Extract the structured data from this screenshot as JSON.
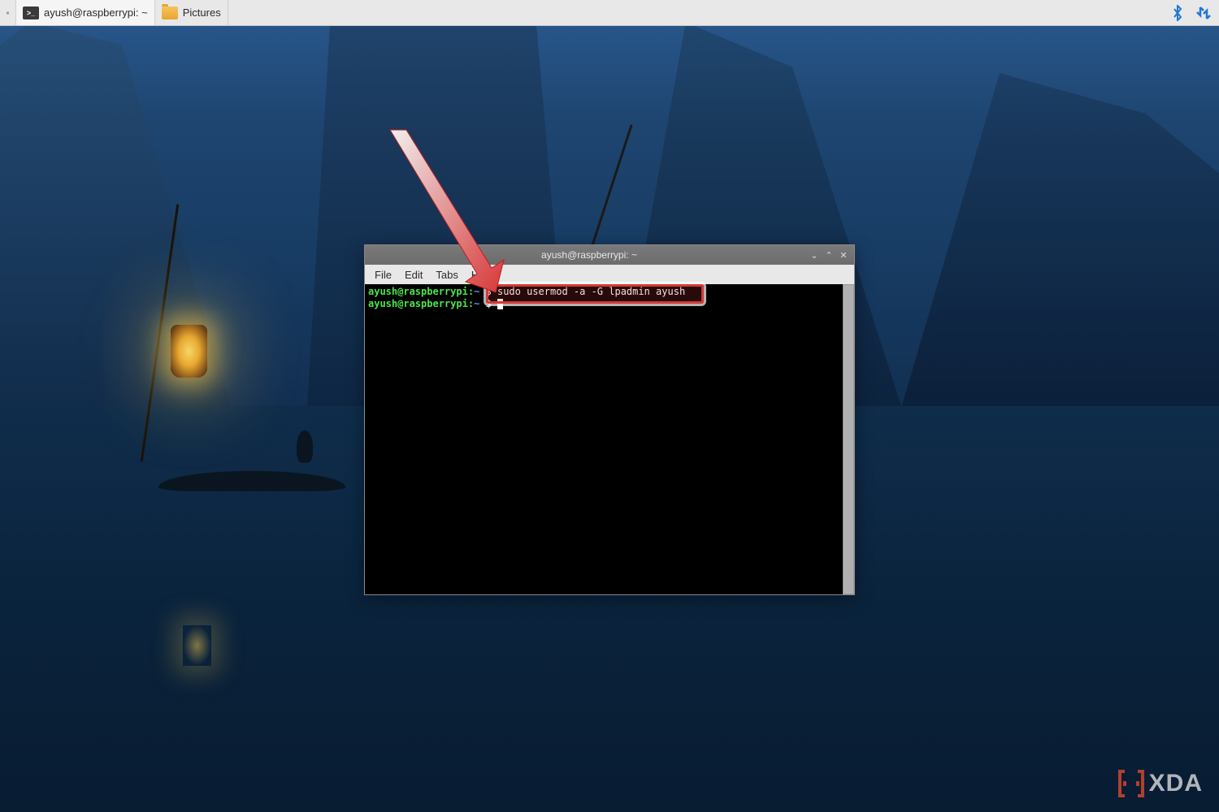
{
  "taskbar": {
    "items": [
      {
        "label": "ayush@raspberrypi: ~",
        "icon": "terminal"
      },
      {
        "label": "Pictures",
        "icon": "folder"
      }
    ],
    "tray": {
      "bluetooth": "bluetooth-icon",
      "network": "network-icon"
    }
  },
  "terminal_window": {
    "title": "ayush@raspberrypi: ~",
    "menu": {
      "file": "File",
      "edit": "Edit",
      "tabs": "Tabs",
      "help": "Help"
    },
    "buttons": {
      "min": "⌄",
      "max": "⌃",
      "close": "✕"
    },
    "lines": [
      {
        "prompt_user": "ayush@raspberrypi",
        "prompt_colon": ":",
        "prompt_path": "~",
        "prompt_dollar": " $ ",
        "input": "sudo usermod -a -G lpadmin ayush"
      },
      {
        "prompt_user": "ayush@raspberrypi",
        "prompt_colon": ":",
        "prompt_path": "~",
        "prompt_dollar": " $ ",
        "input": ""
      }
    ]
  },
  "watermark": {
    "bracket": "[ ]",
    "text": "XDA"
  },
  "colors": {
    "prompt_green": "#4be64b",
    "prompt_blue": "#6a8aff",
    "highlight_red": "#d73838",
    "tray_blue": "#2176d2",
    "xda_orange": "#e84e2c"
  }
}
